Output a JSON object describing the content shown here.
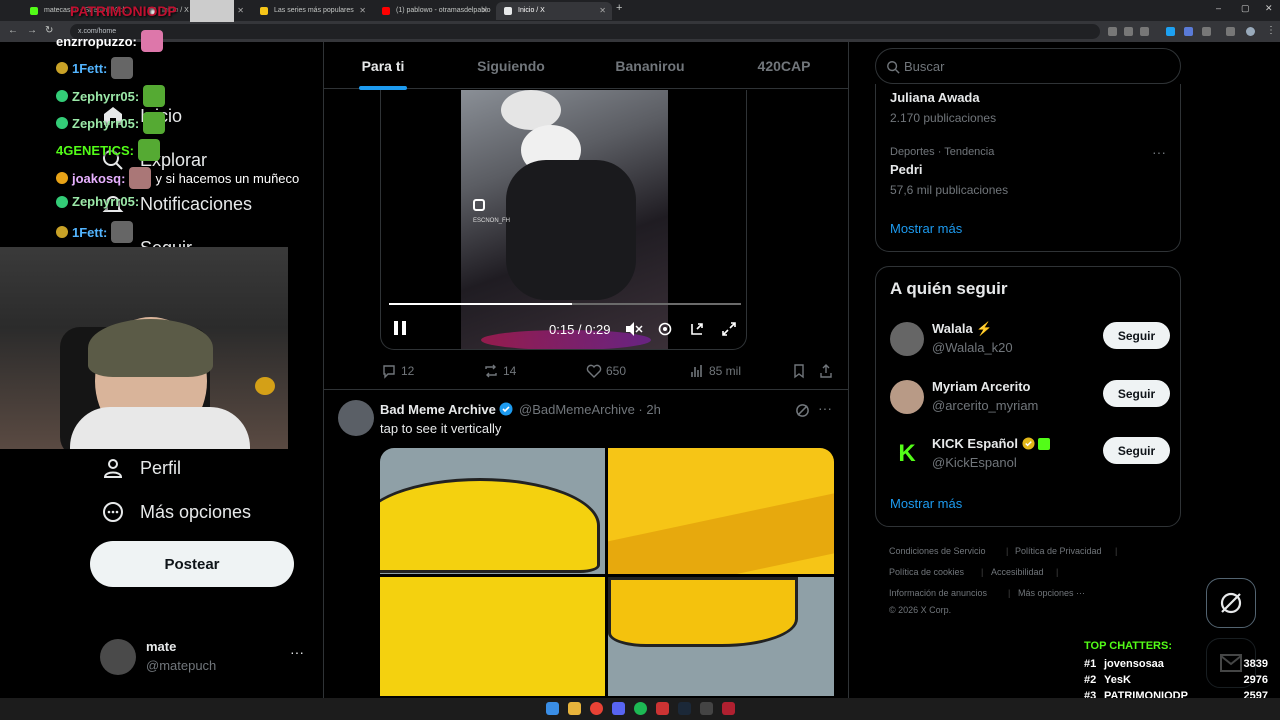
{
  "browser": {
    "tabs": [
      {
        "label": "matecaspu - Stream | Kick",
        "color": "#53fc18"
      },
      {
        "label": "Inicio / X",
        "color": "#e7e9ea"
      },
      {
        "label": "Las series más populares",
        "color": "#f5c518"
      },
      {
        "label": "(1) pablowo - otramasdelpablo",
        "color": "#ff0000"
      },
      {
        "label": "Inicio / X",
        "color": "#e7e9ea"
      }
    ],
    "url": "x.com/home"
  },
  "nav": {
    "home": "Inicio",
    "explore": "Explorar",
    "notifications": "Notificaciones",
    "follow": "Seguir",
    "profile": "Perfil",
    "more": "Más opciones",
    "post": "Postear",
    "account_name": "mate",
    "account_handle": "@matepuch"
  },
  "stream_chat": [
    {
      "user": "enzrropuzzo:",
      "text": "",
      "color": "#ffffff"
    },
    {
      "user": "1Fett:",
      "text": "",
      "color": "#53b5ff"
    },
    {
      "user": "Zephyrr05:",
      "text": "",
      "color": "#9be8a8"
    },
    {
      "user": "Zephyrr05:",
      "text": "",
      "color": "#9be8a8"
    },
    {
      "user": "4GENETICS:",
      "text": "",
      "color": "#53fc18"
    },
    {
      "user": "joakosq:",
      "text": "y si hacemos un muñeco",
      "color": "#e7b0ff"
    },
    {
      "user": "Zephyrr05:",
      "text": "",
      "color": "#9be8a8"
    },
    {
      "user": "1Fett:",
      "text": "",
      "color": "#53b5ff"
    }
  ],
  "stream_overlay_title": "PATRIMONIODP",
  "timeline_tabs": [
    "Para ti",
    "Siguiendo",
    "Bananirou",
    "420CAP"
  ],
  "video": {
    "time": "0:15 / 0:29",
    "progress": 0.52,
    "watermark": "ESCNON_FH"
  },
  "tweet1_actions": {
    "replies": "12",
    "reposts": "14",
    "likes": "650",
    "views": "85 mil"
  },
  "tweet2": {
    "name": "Bad Meme Archive",
    "handle": "@BadMemeArchive · 2h",
    "text": "tap to see it vertically"
  },
  "search": {
    "placeholder": "Buscar"
  },
  "trends": [
    {
      "meta": "",
      "name": "Juliana Awada",
      "posts": "2.170 publicaciones"
    },
    {
      "meta": "Deportes · Tendencia",
      "name": "Pedri",
      "posts": "57,6 mil publicaciones"
    }
  ],
  "trends_more": "Mostrar más",
  "who_to_follow": {
    "title": "A quién seguir",
    "items": [
      {
        "name": "Walala ⚡",
        "handle": "@Walala_k20",
        "button": "Seguir"
      },
      {
        "name": "Myriam Arcerito",
        "handle": "@arcerito_myriam",
        "button": "Seguir"
      },
      {
        "name": "KICK Español",
        "handle": "@KickEspanol",
        "button": "Seguir"
      }
    ],
    "more": "Mostrar más"
  },
  "footer": {
    "terms": "Condiciones de Servicio",
    "privacy": "Política de Privacidad",
    "cookies": "Política de cookies",
    "accessibility": "Accesibilidad",
    "ads": "Información de anuncios",
    "more": "Más opciones ···",
    "copyright": "© 2026 X Corp."
  },
  "top_chatters": {
    "title": "TOP CHATTERS:",
    "rows": [
      {
        "rank": "#1",
        "name": "jovensosaa",
        "count": "3839"
      },
      {
        "rank": "#2",
        "name": "YesK",
        "count": "2976"
      },
      {
        "rank": "#3",
        "name": "PATRIMONIODP",
        "count": "2597"
      }
    ]
  },
  "colors": {
    "accent": "#1d9bf0",
    "kick": "#53fc18",
    "bg": "#000000"
  }
}
